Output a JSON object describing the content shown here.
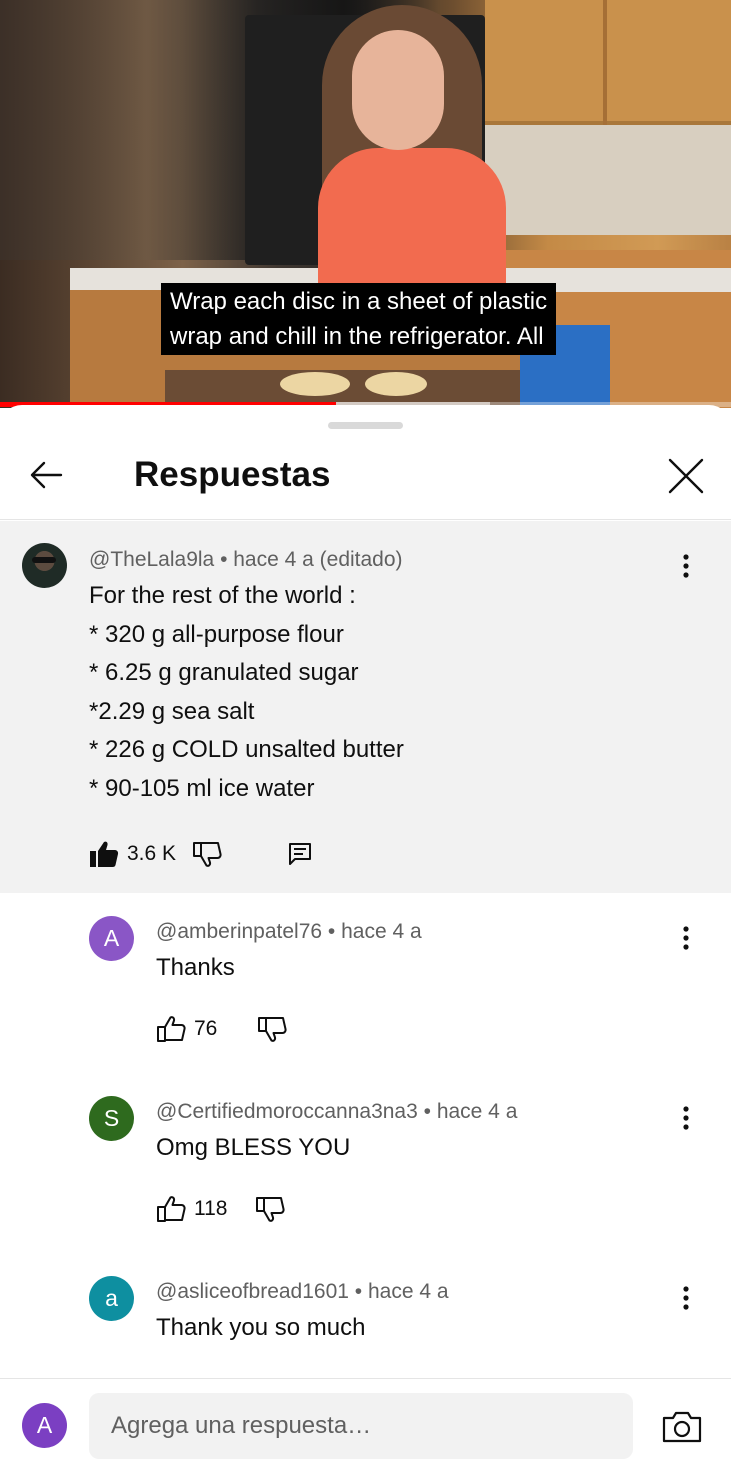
{
  "video": {
    "caption": "Wrap each disc in a sheet of plastic\nwrap and chill in the refrigerator. All",
    "progress": 0.46,
    "buffered": 0.67,
    "accent_color": "#ff0000"
  },
  "header": {
    "title": "Respuestas",
    "back_icon": "arrow-left-icon",
    "close_icon": "close-icon"
  },
  "parent_comment": {
    "author": "@TheLala9la",
    "time": "hace 4 a (editado)",
    "meta": "@TheLala9la • hace 4 a (editado)",
    "text": "For the rest of the world :\n* 320 g all-purpose flour\n* 6.25 g granulated sugar\n*2.29 g sea salt\n* 226 g COLD unsalted butter\n* 90-105 ml ice water",
    "likes": "3.6 K",
    "liked": true
  },
  "replies": [
    {
      "avatar_letter": "A",
      "avatar_color": "#8a56c6",
      "meta": "@amberinpatel76 • hace 4 a",
      "text": "Thanks",
      "likes": "76"
    },
    {
      "avatar_letter": "S",
      "avatar_color": "#2e6a1e",
      "meta": "@Certifiedmoroccanna3na3 • hace 4 a",
      "text": "Omg BLESS YOU",
      "likes": "118"
    },
    {
      "avatar_letter": "a",
      "avatar_color": "#0e8fa0",
      "meta": "@asliceofbread1601 • hace 4 a",
      "text": "Thank you so much",
      "likes": ""
    }
  ],
  "composer": {
    "avatar_letter": "A",
    "avatar_color": "#7b3fc2",
    "placeholder": "Agrega una respuesta…",
    "camera_icon": "camera-icon"
  }
}
